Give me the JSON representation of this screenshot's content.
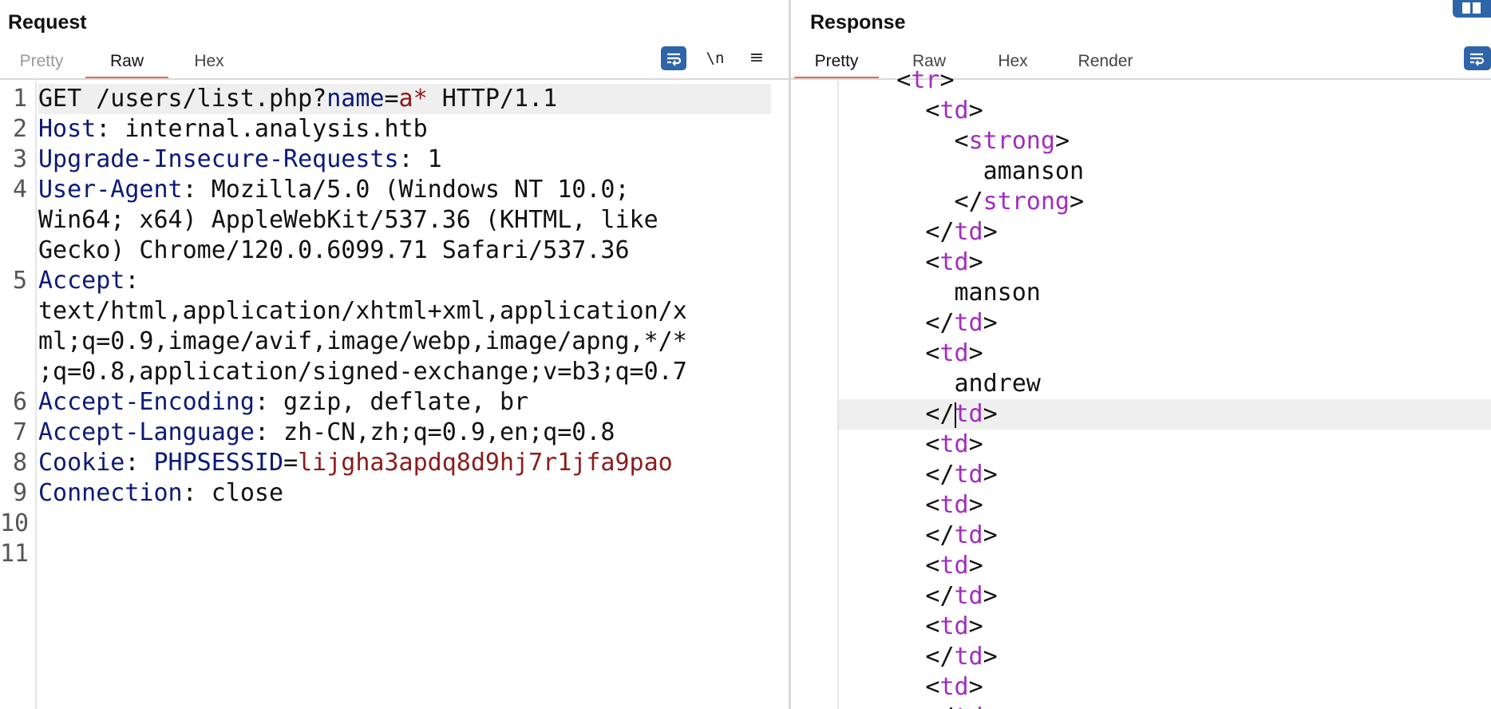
{
  "request": {
    "title": "Request",
    "tabs": [
      "Pretty",
      "Raw",
      "Hex"
    ],
    "active_tab": "Raw",
    "tools": {
      "newline": "\\n",
      "menu": "≡"
    },
    "lines": [
      {
        "n": "1",
        "segs": [
          [
            "t",
            "GET /users/list.php?"
          ],
          [
            "kw",
            "name"
          ],
          [
            "t",
            "="
          ],
          [
            "val",
            "a*"
          ],
          [
            "t",
            " HTTP/1.1"
          ]
        ]
      },
      {
        "n": "2",
        "segs": [
          [
            "kw",
            "Host"
          ],
          [
            "t",
            ": internal.analysis.htb"
          ]
        ]
      },
      {
        "n": "3",
        "segs": [
          [
            "kw",
            "Upgrade-Insecure-Requests"
          ],
          [
            "t",
            ": 1"
          ]
        ]
      },
      {
        "n": "4",
        "segs": [
          [
            "kw",
            "User-Agent"
          ],
          [
            "t",
            ": Mozilla/5.0 (Windows NT 10.0;"
          ]
        ]
      },
      {
        "n": "",
        "segs": [
          [
            "t",
            "Win64; x64) AppleWebKit/537.36 (KHTML, like"
          ]
        ]
      },
      {
        "n": "",
        "segs": [
          [
            "t",
            "Gecko) Chrome/120.0.6099.71 Safari/537.36"
          ]
        ]
      },
      {
        "n": "5",
        "segs": [
          [
            "kw",
            "Accept"
          ],
          [
            "t",
            ":"
          ]
        ]
      },
      {
        "n": "",
        "segs": [
          [
            "t",
            "text/html,application/xhtml+xml,application/x"
          ]
        ]
      },
      {
        "n": "",
        "segs": [
          [
            "t",
            "ml;q=0.9,image/avif,image/webp,image/apng,*/*"
          ]
        ]
      },
      {
        "n": "",
        "segs": [
          [
            "t",
            ";q=0.8,application/signed-exchange;v=b3;q=0.7"
          ]
        ]
      },
      {
        "n": "6",
        "segs": [
          [
            "kw",
            "Accept-Encoding"
          ],
          [
            "t",
            ": gzip, deflate, br"
          ]
        ]
      },
      {
        "n": "7",
        "segs": [
          [
            "kw",
            "Accept-Language"
          ],
          [
            "t",
            ": zh-CN,zh;q=0.9,en;q=0.8"
          ]
        ]
      },
      {
        "n": "8",
        "segs": [
          [
            "kw",
            "Cookie"
          ],
          [
            "t",
            ": "
          ],
          [
            "kw",
            "PHPSESSID"
          ],
          [
            "t",
            "="
          ],
          [
            "val",
            "lijgha3apdq8d9hj7r1jfa9pao"
          ]
        ]
      },
      {
        "n": "9",
        "segs": [
          [
            "kw",
            "Connection"
          ],
          [
            "t",
            ": close"
          ]
        ]
      },
      {
        "n": "10",
        "segs": []
      },
      {
        "n": "11",
        "segs": []
      }
    ]
  },
  "response": {
    "title": "Response",
    "tabs": [
      "Pretty",
      "Raw",
      "Hex",
      "Render"
    ],
    "active_tab": "Pretty",
    "lines": [
      {
        "indent": 2,
        "open": true,
        "tag": "tr",
        "partial": true
      },
      {
        "indent": 3,
        "open": true,
        "tag": "td"
      },
      {
        "indent": 4,
        "open": true,
        "tag": "strong"
      },
      {
        "indent": 5,
        "text": "amanson"
      },
      {
        "indent": 4,
        "open": false,
        "tag": "strong"
      },
      {
        "indent": 3,
        "open": false,
        "tag": "td"
      },
      {
        "indent": 3,
        "open": true,
        "tag": "td"
      },
      {
        "indent": 4,
        "text": "manson"
      },
      {
        "indent": 3,
        "open": false,
        "tag": "td"
      },
      {
        "indent": 3,
        "open": true,
        "tag": "td"
      },
      {
        "indent": 4,
        "text": "andrew"
      },
      {
        "indent": 3,
        "open": false,
        "tag": "td",
        "caret": true
      },
      {
        "indent": 3,
        "open": true,
        "tag": "td"
      },
      {
        "indent": 3,
        "open": false,
        "tag": "td"
      },
      {
        "indent": 3,
        "open": true,
        "tag": "td"
      },
      {
        "indent": 3,
        "open": false,
        "tag": "td"
      },
      {
        "indent": 3,
        "open": true,
        "tag": "td"
      },
      {
        "indent": 3,
        "open": false,
        "tag": "td"
      },
      {
        "indent": 3,
        "open": true,
        "tag": "td"
      },
      {
        "indent": 3,
        "open": false,
        "tag": "td"
      },
      {
        "indent": 3,
        "open": true,
        "tag": "td"
      },
      {
        "indent": 3,
        "open": false,
        "tag": "td",
        "partial": true
      }
    ]
  },
  "colors": {
    "keyword": "#0b1a78",
    "value": "#8b1c1c",
    "tag": "#a12dbf",
    "accent": "#e46c4b",
    "button": "#2e64a8"
  },
  "icons": [
    "wrap-lines-icon",
    "newline-icon",
    "menu-icon",
    "layout-icon"
  ]
}
